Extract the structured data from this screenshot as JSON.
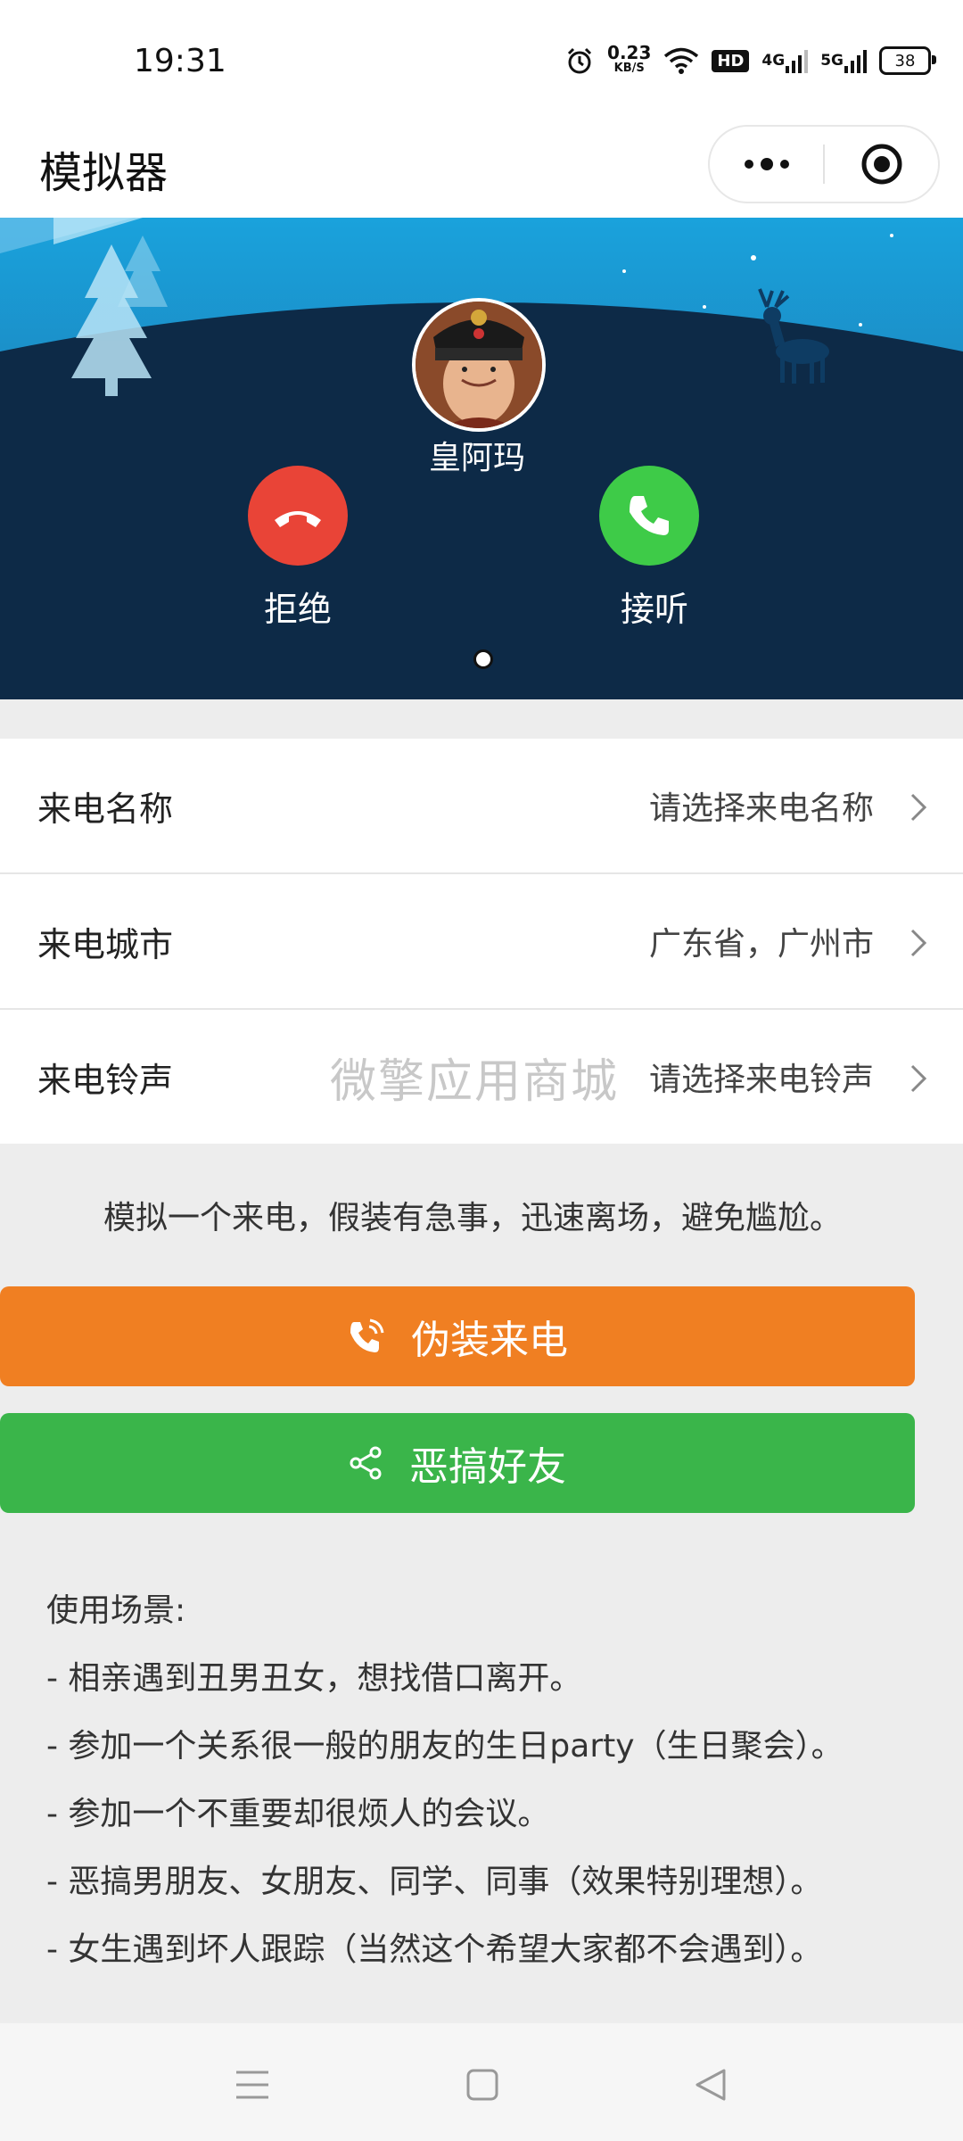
{
  "status_bar": {
    "time": "19:31",
    "net_speed_value": "0.23",
    "net_speed_unit": "KB/S",
    "hd_badge": "HD",
    "net_4g": "4G",
    "net_5g": "5G",
    "battery": "38"
  },
  "header": {
    "title": "模拟器"
  },
  "banner": {
    "caller_name": "皇阿玛",
    "decline_label": "拒绝",
    "accept_label": "接听"
  },
  "form": {
    "rows": [
      {
        "label": "来电名称",
        "value": "请选择来电名称"
      },
      {
        "label": "来电城市",
        "value": "广东省，广州市"
      },
      {
        "label": "来电铃声",
        "value": "请选择来电铃声"
      }
    ],
    "watermark": "微擎应用商城"
  },
  "tagline": "模拟一个来电，假装有急事，迅速离场，避免尴尬。",
  "buttons": {
    "fake_call": "伪装来电",
    "prank_friend": "恶搞好友"
  },
  "usage": {
    "title": "使用场景:",
    "items": [
      "- 相亲遇到丑男丑女，想找借口离开。",
      "- 参加一个关系很一般的朋友的生日party（生日聚会）。",
      "- 参加一个不重要却很烦人的会议。",
      "- 恶搞男朋友、女朋友、同学、同事（效果特别理想）。",
      "- 女生遇到坏人跟踪（当然这个希望大家都不会遇到）。"
    ]
  },
  "colors": {
    "orange": "#f07f22",
    "green": "#3ab54a",
    "decline_red": "#e94437",
    "accept_green": "#3ecb48"
  }
}
